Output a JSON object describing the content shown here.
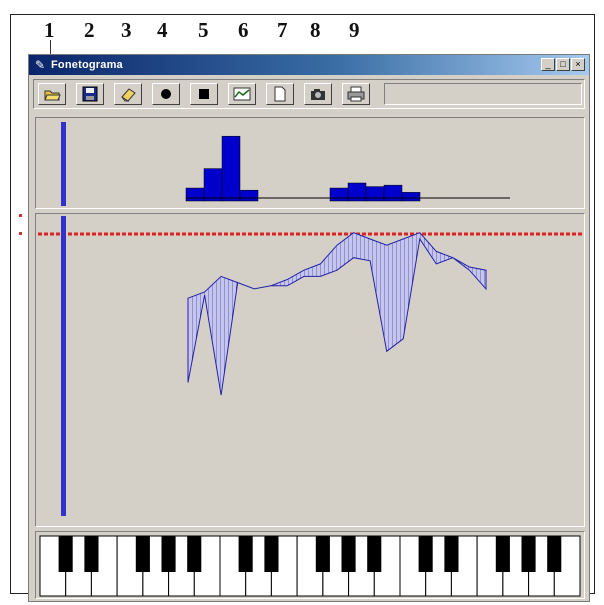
{
  "annotation_numbers": [
    "1",
    "2",
    "3",
    "4",
    "5",
    "6",
    "7",
    "8",
    "9"
  ],
  "window": {
    "title": "Fonetograma",
    "buttons": {
      "minimize": "_",
      "maximize": "□",
      "close": "×"
    }
  },
  "toolbar": {
    "tools": [
      {
        "icon": "open-folder-icon"
      },
      {
        "icon": "save-disk-icon"
      },
      {
        "icon": "eraser-icon"
      },
      {
        "icon": "record-icon"
      },
      {
        "icon": "stop-icon"
      },
      {
        "icon": "graph-icon"
      },
      {
        "icon": "new-document-icon"
      },
      {
        "icon": "camera-icon"
      },
      {
        "icon": "printer-icon"
      }
    ]
  },
  "colors": {
    "histogram_bar": "#0000cc",
    "cursor_line": "#3333cc",
    "reference_line": "#dd2222",
    "phonetogram_fill": "#aaaae6",
    "phonetogram_stroke": "#2222aa",
    "window_bg": "#d4d0c8"
  },
  "histogram": {
    "levels": [
      0.18,
      0.45,
      0.9,
      0.15,
      0.05,
      0.05,
      0.05,
      0.05,
      0.18,
      0.25,
      0.2,
      0.22,
      0.12,
      0.05,
      0.05,
      0.08,
      0.05,
      0.08
    ]
  },
  "phonetogram": {
    "upper": [
      0.73,
      0.75,
      0.8,
      0.78,
      0.76,
      0.77,
      0.79,
      0.82,
      0.84,
      0.9,
      0.94,
      0.92,
      0.9,
      0.92,
      0.94,
      0.88,
      0.86,
      0.83,
      0.82
    ],
    "lower": [
      0.46,
      0.74,
      0.42,
      0.78,
      0.76,
      0.77,
      0.77,
      0.8,
      0.8,
      0.82,
      0.86,
      0.85,
      0.56,
      0.6,
      0.92,
      0.84,
      0.86,
      0.82,
      0.76
    ]
  },
  "keyboard": {
    "white_keys": 21,
    "black_pattern": [
      1,
      1,
      0,
      1,
      1,
      1,
      0
    ]
  }
}
